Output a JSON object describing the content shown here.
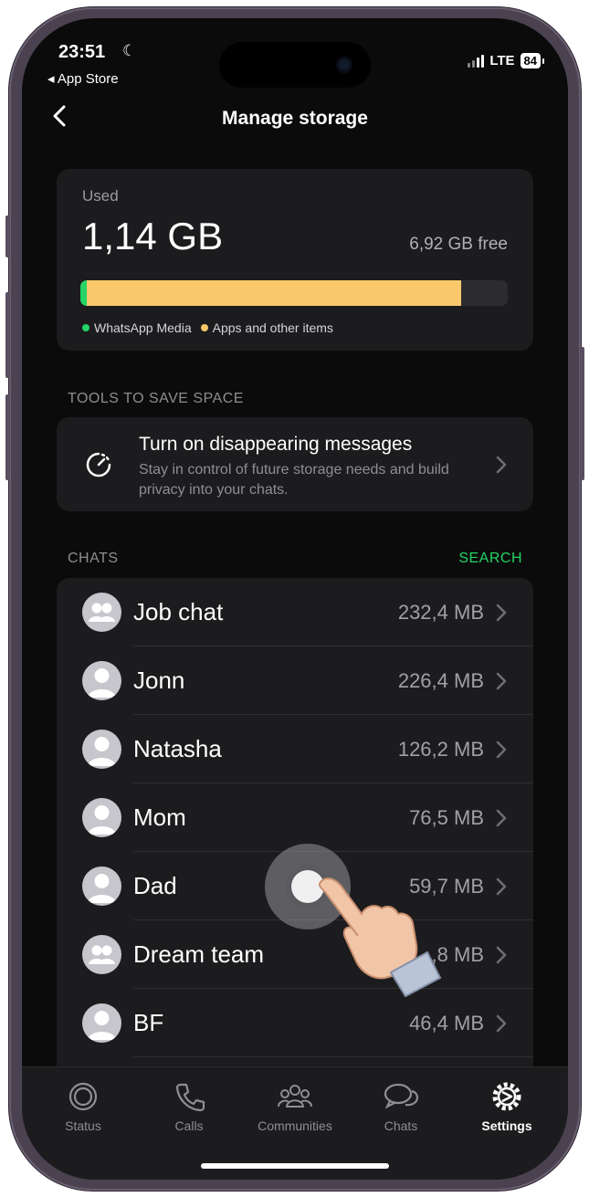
{
  "status_bar": {
    "time": "23:51",
    "back_app": "◂ App Store",
    "network": "LTE",
    "battery": "84"
  },
  "nav": {
    "title": "Manage storage",
    "back_icon": "chevron-left-icon"
  },
  "storage": {
    "used_label": "Used",
    "used_value": "1,14 GB",
    "free_value": "6,92 GB free",
    "whatsapp_fraction": 0.015,
    "apps_fraction": 0.875,
    "legend": [
      {
        "label": "WhatsApp Media",
        "color": "#25d366"
      },
      {
        "label": "Apps and other items",
        "color": "#f9c86a"
      }
    ]
  },
  "tools": {
    "header": "TOOLS TO SAVE SPACE",
    "item": {
      "title": "Turn on disappearing messages",
      "description": "Stay in control of future storage needs and build privacy into your chats.",
      "icon": "timer-icon"
    }
  },
  "chats": {
    "header": "CHATS",
    "search_label": "SEARCH",
    "items": [
      {
        "name": "Job chat",
        "size": "232,4 MB",
        "avatar": "group"
      },
      {
        "name": "Jonn",
        "size": "226,4 MB",
        "avatar": "person"
      },
      {
        "name": "Natasha",
        "size": "126,2 MB",
        "avatar": "person"
      },
      {
        "name": "Mom",
        "size": "76,5 MB",
        "avatar": "person"
      },
      {
        "name": "Dad",
        "size": "59,7 MB",
        "avatar": "person"
      },
      {
        "name": "Dream team",
        "size": ",8 MB",
        "avatar": "group"
      },
      {
        "name": "BF",
        "size": "46,4 MB",
        "avatar": "person"
      }
    ]
  },
  "tabbar": {
    "items": [
      {
        "label": "Status",
        "icon": "status-icon",
        "active": false
      },
      {
        "label": "Calls",
        "icon": "phone-icon",
        "active": false
      },
      {
        "label": "Communities",
        "icon": "communities-icon",
        "active": false
      },
      {
        "label": "Chats",
        "icon": "chat-bubbles-icon",
        "active": false
      },
      {
        "label": "Settings",
        "icon": "gear-icon",
        "active": true
      }
    ]
  },
  "colors": {
    "accent": "#25d366",
    "apps_bar": "#f9c86a",
    "background": "#0b0b0b",
    "card": "#1c1c1e"
  }
}
